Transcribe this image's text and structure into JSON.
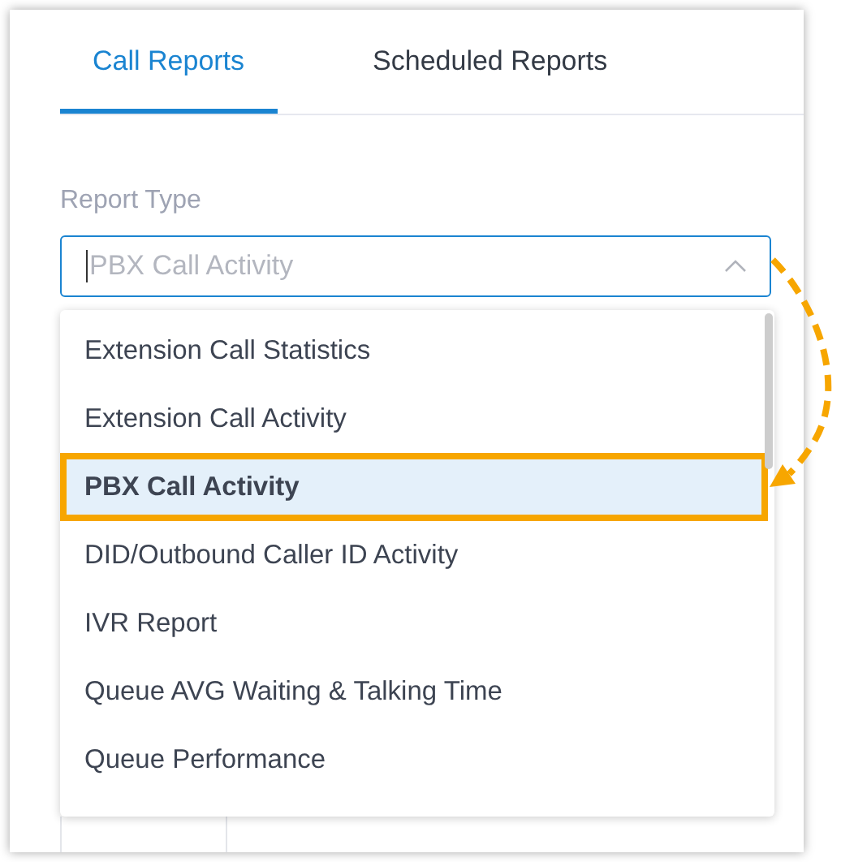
{
  "tabs": [
    {
      "label": "Call Reports",
      "selected": true
    },
    {
      "label": "Scheduled Reports",
      "selected": false
    }
  ],
  "report_type": {
    "label": "Report Type",
    "placeholder": "PBX Call Activity",
    "expanded": true
  },
  "options": [
    {
      "label": "Extension Call Statistics",
      "selected": false,
      "highlighted": false
    },
    {
      "label": "Extension Call Activity",
      "selected": false,
      "highlighted": false
    },
    {
      "label": "PBX Call Activity",
      "selected": true,
      "highlighted": true
    },
    {
      "label": "DID/Outbound Caller ID Activity",
      "selected": false,
      "highlighted": false
    },
    {
      "label": "IVR Report",
      "selected": false,
      "highlighted": false
    },
    {
      "label": "Queue AVG Waiting & Talking Time",
      "selected": false,
      "highlighted": false
    },
    {
      "label": "Queue Performance",
      "selected": false,
      "highlighted": false
    }
  ]
}
